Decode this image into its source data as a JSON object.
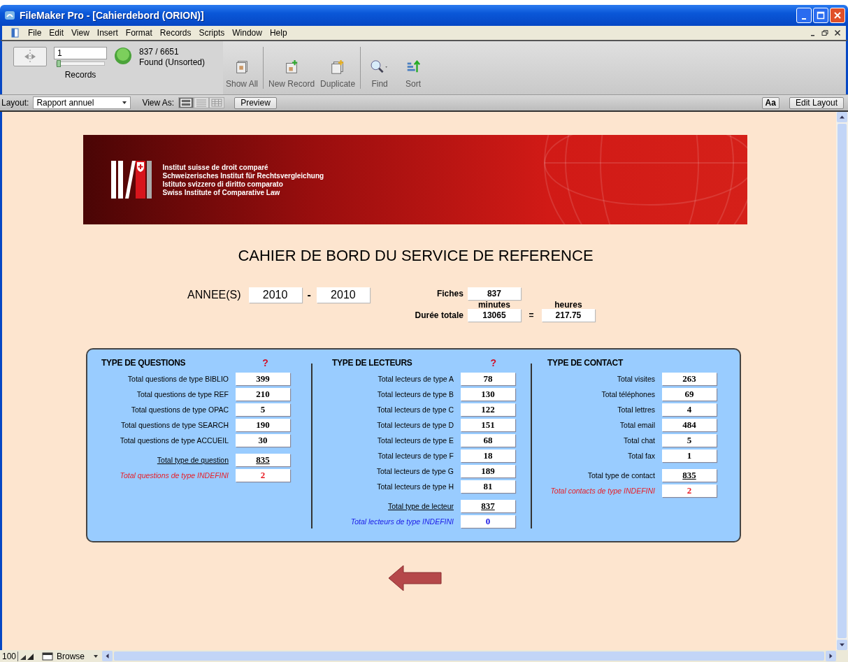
{
  "window": {
    "title": "FileMaker Pro - [Cahierdebord (ORION)]"
  },
  "menu": [
    "File",
    "Edit",
    "View",
    "Insert",
    "Format",
    "Records",
    "Scripts",
    "Window",
    "Help"
  ],
  "toolbar": {
    "record": "1",
    "record_position": {
      "level": 0
    },
    "records_label": "Records",
    "found_count": "837 / 6651",
    "found_status": "Found (Unsorted)",
    "buttons": [
      {
        "kind": "show_all",
        "label": "Show All"
      },
      {
        "kind": "new_record",
        "label": "New Record"
      },
      {
        "kind": "duplicate",
        "label": "Duplicate"
      },
      {
        "kind": "find",
        "label": "Find"
      },
      {
        "kind": "sort",
        "label": "Sort"
      }
    ]
  },
  "layout_bar": {
    "layout_label": "Layout:",
    "layout": "Rapport annuel",
    "view_as_label": "View As:",
    "view_modes": [
      {
        "kind": "form",
        "selected": true
      },
      {
        "kind": "list",
        "selected": false
      },
      {
        "kind": "table",
        "selected": false
      }
    ],
    "preview": "Preview",
    "font_button": "Aa",
    "edit_layout": "Edit Layout"
  },
  "banner": {
    "lines": [
      "Institut suisse de droit comparé",
      "Schweizerisches Institut für Rechtsvergleichung",
      "Istituto svizzero di diritto comparato",
      "Swiss Institute of Comparative Law"
    ]
  },
  "report": {
    "title": "CAHIER DE BORD DU SERVICE DE REFERENCE",
    "years_label": "ANNEE(S)",
    "year_from": "2010",
    "year_sep": "-",
    "year_to": "2010",
    "fiches_label": "Fiches",
    "fiches": "837",
    "minutes_label": "minutes",
    "hours_label": "heures",
    "duration_label": "Durée totale",
    "minutes": "13065",
    "equals": "=",
    "hours": "217.75"
  },
  "sections": [
    {
      "title": "TYPE DE QUESTIONS",
      "help": "?",
      "rows": [
        {
          "kind": "item",
          "label": "Total questions de type BIBLIO",
          "value": "399"
        },
        {
          "kind": "item",
          "label": "Total questions de type REF",
          "value": "210"
        },
        {
          "kind": "item",
          "label": "Total questions de type OPAC",
          "value": "5"
        },
        {
          "kind": "item",
          "label": "Total questions de type SEARCH",
          "value": "190"
        },
        {
          "kind": "item",
          "label": "Total questions de type ACCUEIL",
          "value": "30"
        },
        {
          "kind": "total",
          "label": "Total type de question",
          "value": "835"
        },
        {
          "kind": "undefined",
          "label": "Total questions de type INDEFINI",
          "value": "2",
          "color": "#e81c24"
        }
      ]
    },
    {
      "title": "TYPE DE LECTEURS",
      "help": "?",
      "rows": [
        {
          "kind": "item",
          "label": "Total lecteurs de type A",
          "value": "78"
        },
        {
          "kind": "item",
          "label": "Total lecteurs de type B",
          "value": "130"
        },
        {
          "kind": "item",
          "label": "Total lecteurs de type C",
          "value": "122"
        },
        {
          "kind": "item",
          "label": "Total lecteurs de type D",
          "value": "151"
        },
        {
          "kind": "item",
          "label": "Total lecteurs de type E",
          "value": "68"
        },
        {
          "kind": "item",
          "label": "Total lecteurs de type F",
          "value": "18"
        },
        {
          "kind": "item",
          "label": "Total lecteurs de type G",
          "value": "189"
        },
        {
          "kind": "item",
          "label": "Total lecteurs de type H",
          "value": "81"
        },
        {
          "kind": "total",
          "label": "Total type de lecteur",
          "value": "837"
        },
        {
          "kind": "undefined",
          "label": "Total lecteurs de type INDEFINI",
          "value": "0",
          "color": "#1a1ae6"
        }
      ]
    },
    {
      "title": "TYPE DE CONTACT",
      "rows": [
        {
          "kind": "item",
          "label": "Total visites",
          "value": "263"
        },
        {
          "kind": "item",
          "label": "Total téléphones",
          "value": "69"
        },
        {
          "kind": "item",
          "label": "Total lettres",
          "value": "4"
        },
        {
          "kind": "item",
          "label": "Total email",
          "value": "484"
        },
        {
          "kind": "item",
          "label": "Total chat",
          "value": "5"
        },
        {
          "kind": "item",
          "label": "Total fax",
          "value": "1"
        },
        {
          "kind": "plain_total",
          "label": "Total type de contact",
          "value": "835"
        },
        {
          "kind": "undefined",
          "label": "Total contacts de type INDEFINI",
          "value": "2",
          "color": "#e81c24"
        }
      ]
    }
  ],
  "status_bar": {
    "zoom": "100",
    "mode": "Browse"
  }
}
